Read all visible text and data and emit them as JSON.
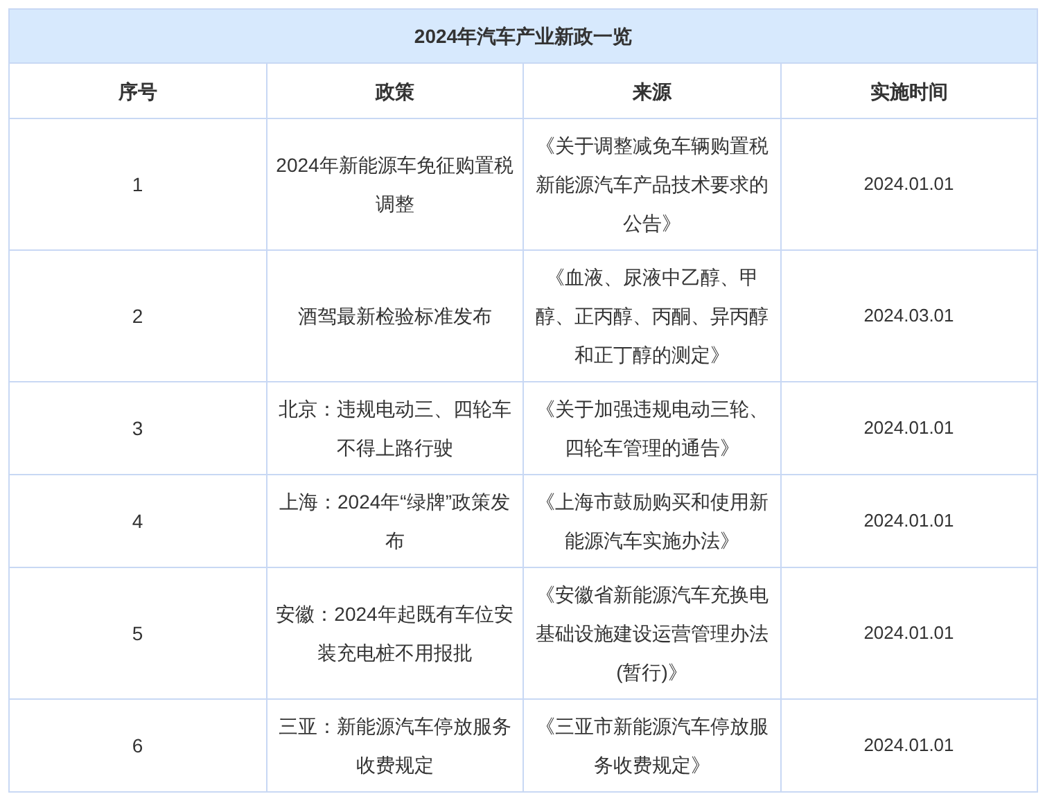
{
  "table": {
    "title": "2024年汽车产业新政一览",
    "columns": [
      "序号",
      "政策",
      "来源",
      "实施时间"
    ],
    "rows": [
      {
        "number": "1",
        "policy": "2024年新能源车免征购置税调整",
        "source": "《关于调整减免车辆购置税新能源汽车产品技术要求的公告》",
        "date": "2024.01.01"
      },
      {
        "number": "2",
        "policy": "酒驾最新检验标准发布",
        "source": "《血液、尿液中乙醇、甲醇、正丙醇、丙酮、异丙醇和正丁醇的测定》",
        "date": "2024.03.01"
      },
      {
        "number": "3",
        "policy": "北京：违规电动三、四轮车不得上路行驶",
        "source": "《关于加强违规电动三轮、四轮车管理的通告》",
        "date": "2024.01.01"
      },
      {
        "number": "4",
        "policy": "上海：2024年“绿牌”政策发布",
        "source": "《上海市鼓励购买和使用新能源汽车实施办法》",
        "date": "2024.01.01"
      },
      {
        "number": "5",
        "policy": "安徽：2024年起既有车位安装充电桩不用报批",
        "source": "《安徽省新能源汽车充换电基础设施建设运营管理办法(暂行)》",
        "date": "2024.01.01"
      },
      {
        "number": "6",
        "policy": "三亚：新能源汽车停放服务收费规定",
        "source": "《三亚市新能源汽车停放服务收费规定》",
        "date": "2024.01.01"
      }
    ]
  }
}
